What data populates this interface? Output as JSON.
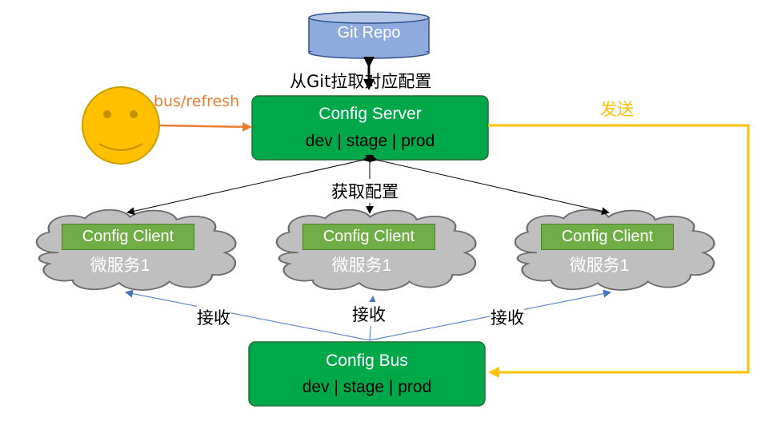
{
  "git_repo": {
    "label": "Git Repo"
  },
  "config_server": {
    "title": "Config Server",
    "envs": "dev | stage | prod"
  },
  "config_bus": {
    "title": "Config Bus",
    "envs": "dev | stage | prod"
  },
  "clients": [
    {
      "title": "Config Client",
      "subtitle": "微服务1"
    },
    {
      "title": "Config Client",
      "subtitle": "微服务1"
    },
    {
      "title": "Config Client",
      "subtitle": "微服务1"
    }
  ],
  "edges": {
    "pull_from_git": "从Git拉取对应配置",
    "bus_refresh": "bus/refresh",
    "send": "发送",
    "fetch_config": "获取配置",
    "receive_left": "接收",
    "receive_middle": "接收",
    "receive_right": "接收"
  },
  "colors": {
    "server_fill": "#00a84a",
    "git_fill": "#8faadc",
    "cloud_fill": "#bfbfbf",
    "client_fill": "#70ad47",
    "send_arrow": "#ffc000",
    "refresh_arrow": "#ed7d31",
    "receive_arrow": "#4472c4",
    "smiley_fill": "#ffc000"
  }
}
